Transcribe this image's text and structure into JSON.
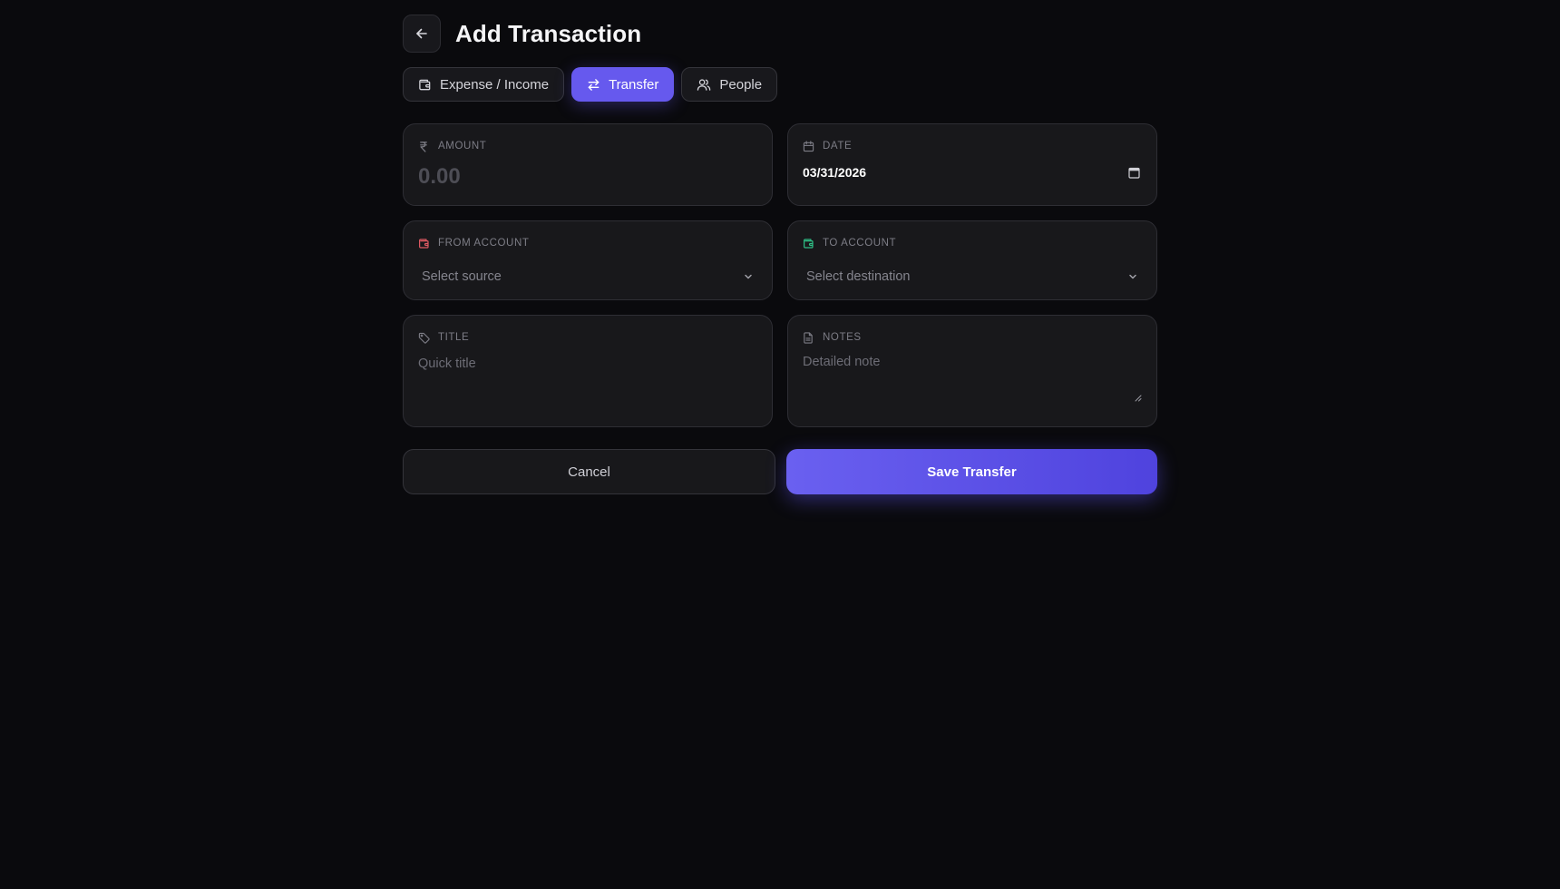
{
  "header": {
    "title": "Add Transaction",
    "back_icon": "arrow-left-icon"
  },
  "tabs": [
    {
      "label": "Expense / Income",
      "icon": "wallet-icon",
      "active": false
    },
    {
      "label": "Transfer",
      "icon": "arrows-swap-icon",
      "active": true
    },
    {
      "label": "People",
      "icon": "users-icon",
      "active": false
    }
  ],
  "form": {
    "amount": {
      "label": "AMOUNT",
      "placeholder": "0.00",
      "icon": "rupee-icon"
    },
    "date": {
      "label": "DATE",
      "value": "03/31/2026",
      "icon": "calendar-icon"
    },
    "from_account": {
      "label": "FROM ACCOUNT",
      "placeholder": "Select source",
      "icon": "wallet-icon"
    },
    "to_account": {
      "label": "TO ACCOUNT",
      "placeholder": "Select destination",
      "icon": "wallet-icon"
    },
    "title": {
      "label": "TITLE",
      "placeholder": "Quick title",
      "icon": "tag-icon"
    },
    "notes": {
      "label": "NOTES",
      "placeholder": "Detailed note",
      "icon": "document-icon"
    }
  },
  "actions": {
    "cancel_label": "Cancel",
    "save_label": "Save Transfer"
  },
  "colors": {
    "background": "#0a0a0d",
    "card": "#18181b",
    "accent": "#6659ee",
    "from_icon": "#e05a63",
    "to_icon": "#2fbf86"
  }
}
